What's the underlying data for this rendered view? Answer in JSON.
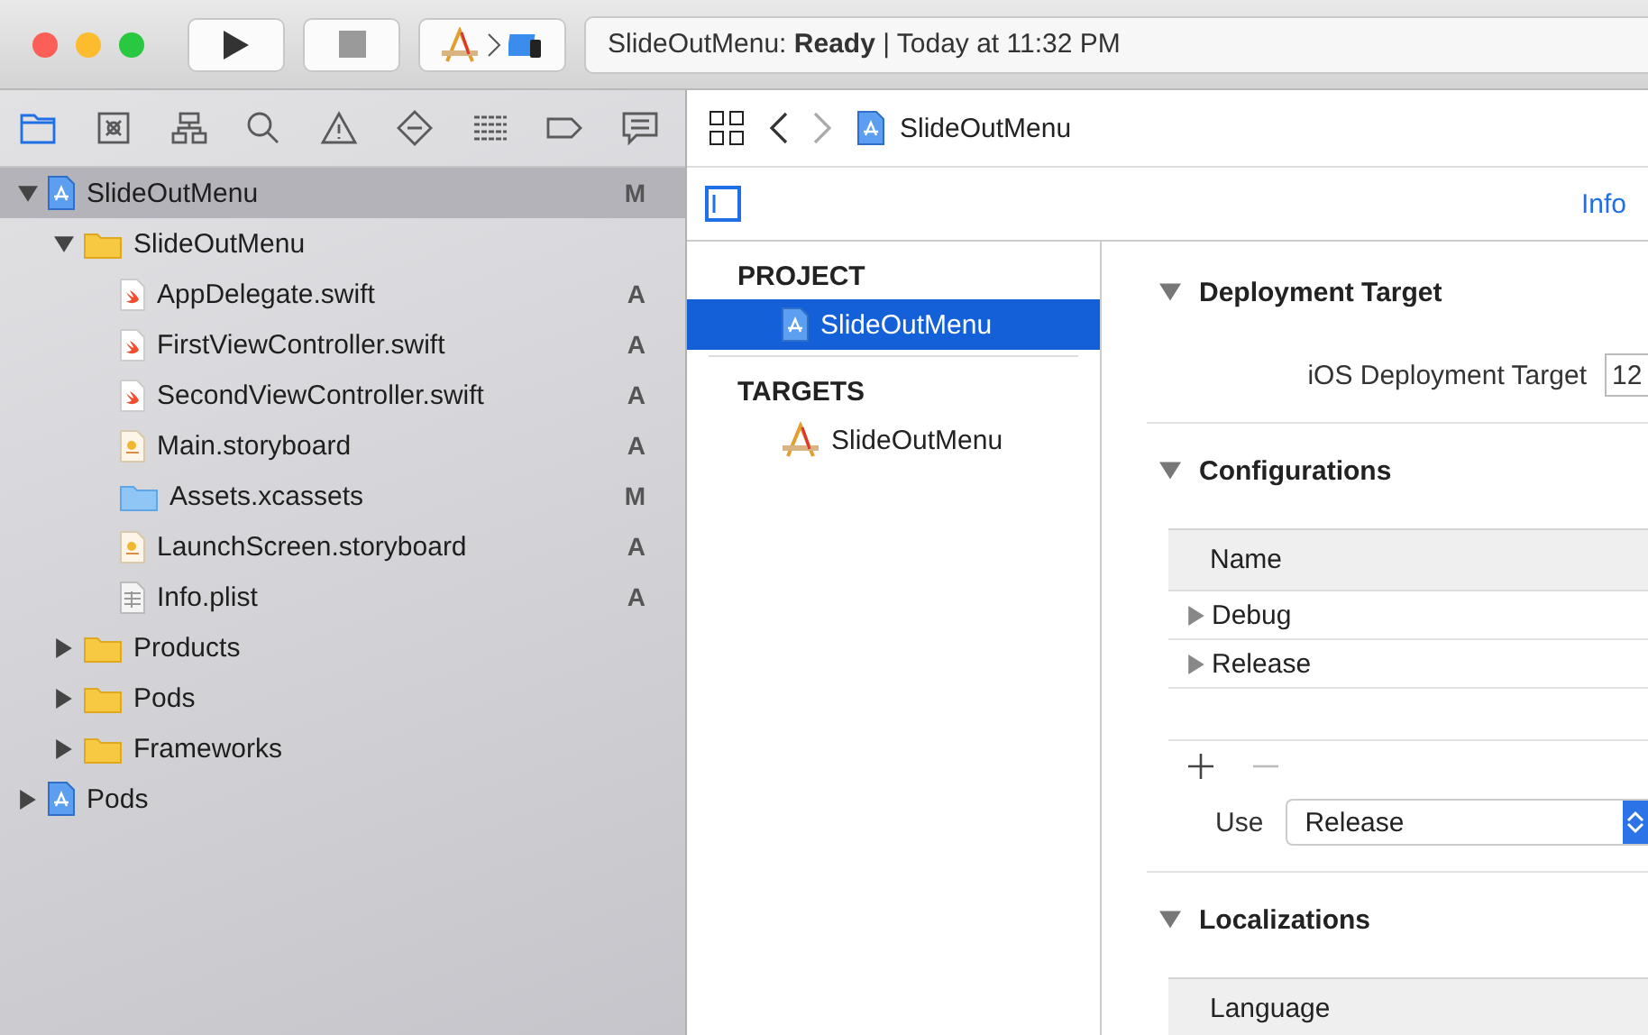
{
  "window": {
    "status": "SlideOutMenu: **Ready** | Today at 11:32 PM"
  },
  "navigator_tabs": [
    {
      "kind": "folder",
      "selected": true
    },
    {
      "kind": "source",
      "selected": false
    },
    {
      "kind": "hierarchy",
      "selected": false
    },
    {
      "kind": "search",
      "selected": false
    },
    {
      "kind": "warning",
      "selected": false
    },
    {
      "kind": "test",
      "selected": false
    },
    {
      "kind": "debug",
      "selected": false
    },
    {
      "kind": "breakpoint",
      "selected": false
    },
    {
      "kind": "report",
      "selected": false
    }
  ],
  "tree": [
    {
      "name": "SlideOutMenu",
      "kind": "project",
      "badge": "M",
      "expanded": true,
      "selected": true,
      "children": [
        {
          "name": "SlideOutMenu",
          "kind": "folder",
          "expanded": true,
          "selected": false,
          "children": [
            {
              "name": "AppDelegate.swift",
              "kind": "swift",
              "badge": "A",
              "selected": false
            },
            {
              "name": "FirstViewController.swift",
              "kind": "swift",
              "badge": "A",
              "selected": false
            },
            {
              "name": "SecondViewController.swift",
              "kind": "swift",
              "badge": "A",
              "selected": false
            },
            {
              "name": "Main.storyboard",
              "kind": "storyboard",
              "badge": "A",
              "selected": false
            },
            {
              "name": "Assets.xcassets",
              "kind": "assets",
              "badge": "M",
              "selected": false
            },
            {
              "name": "LaunchScreen.storyboard",
              "kind": "storyboard",
              "badge": "A",
              "selected": false
            },
            {
              "name": "Info.plist",
              "kind": "plist",
              "badge": "A",
              "selected": false
            }
          ]
        },
        {
          "name": "Products",
          "kind": "folder",
          "expanded": false,
          "selected": false
        },
        {
          "name": "Pods",
          "kind": "folder",
          "expanded": false,
          "selected": false
        },
        {
          "name": "Frameworks",
          "kind": "folder",
          "expanded": false,
          "selected": false
        }
      ]
    },
    {
      "name": "Pods",
      "kind": "project",
      "expanded": false,
      "selected": false
    }
  ],
  "jump_bar": {
    "path": "SlideOutMenu"
  },
  "editor_tabs": [
    {
      "label": "Info",
      "selected": true
    }
  ],
  "project_list": [
    {
      "heading": "PROJECT",
      "items": [
        {
          "name": "SlideOutMenu",
          "kind": "project",
          "selected": true
        }
      ]
    },
    {
      "heading": "TARGETS",
      "items": [
        {
          "name": "SlideOutMenu",
          "kind": "app",
          "selected": false
        }
      ]
    }
  ],
  "settings": [
    {
      "title": "Deployment Target",
      "expanded": true,
      "kind": "field",
      "label": "iOS Deployment Target",
      "value": "12"
    },
    {
      "title": "Configurations",
      "expanded": true,
      "kind": "table",
      "column": "Name",
      "rows": [
        "Debug",
        "Release"
      ],
      "use_label": "Use",
      "use_value": "Release"
    },
    {
      "title": "Localizations",
      "expanded": true,
      "kind": "header",
      "column": "Language"
    }
  ]
}
